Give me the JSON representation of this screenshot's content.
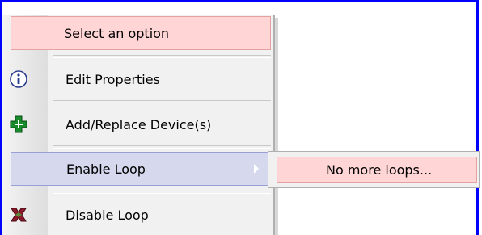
{
  "menu": {
    "header": "Select an option",
    "items": [
      {
        "label": "Edit Properties",
        "icon": "info-icon"
      },
      {
        "label": "Add/Replace Device(s)",
        "icon": "green-cross-icon"
      },
      {
        "label": "Enable Loop",
        "icon": "none",
        "has_submenu": true,
        "highlighted": true
      },
      {
        "label": "Disable Loop",
        "icon": "disconnect-icon"
      }
    ]
  },
  "submenu": {
    "items": [
      {
        "label": "No more loops..."
      }
    ]
  },
  "colors": {
    "frame_border": "#0000ff",
    "menu_bg": "#f1f1f1",
    "header_bg": "#ffd5d5",
    "highlight_bg": "#d6d9ee",
    "submenu_item_bg": "#ffd5d5"
  }
}
